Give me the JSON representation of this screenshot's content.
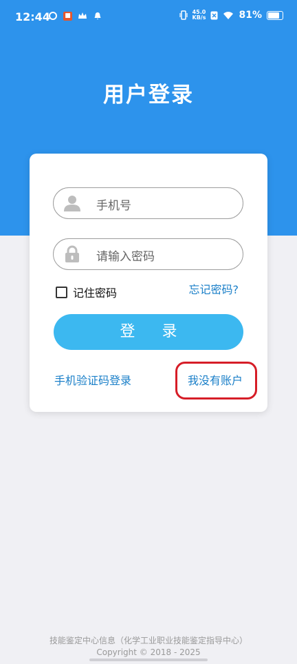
{
  "status_bar": {
    "time": "12:44",
    "net_speed_value": "45.0",
    "net_speed_unit": "KB/s",
    "battery": "81%"
  },
  "header": {
    "title": "用户登录"
  },
  "form": {
    "phone_placeholder": "手机号",
    "password_placeholder": "请输入密码",
    "remember_label": "记住密码",
    "remember_checked": false,
    "forgot_link": "忘记密码?",
    "login_button": "登 录",
    "sms_login_link": "手机验证码登录",
    "no_account_link": "我没有账户"
  },
  "footer": {
    "line1": "技能鉴定中心信息（化学工业职业技能鉴定指导中心）",
    "line2": "Copyright © 2018 - 2025"
  },
  "colors": {
    "header_bg": "#2d93ec",
    "button_bg": "#3cb8f0",
    "link": "#1a7fc8",
    "highlight": "#d61d27"
  }
}
